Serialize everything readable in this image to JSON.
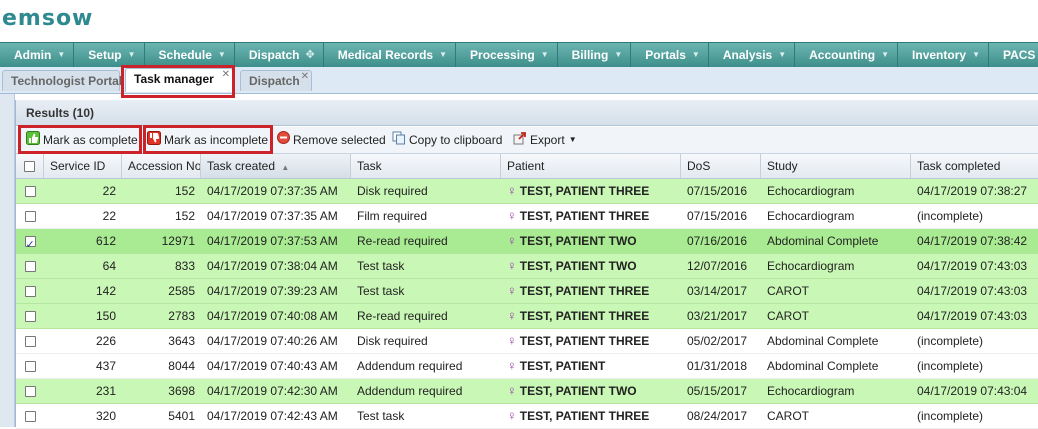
{
  "logo": {
    "text": "emsow"
  },
  "nav": [
    {
      "label": "Admin"
    },
    {
      "label": "Setup"
    },
    {
      "label": "Schedule"
    },
    {
      "label": "Dispatch",
      "active": true
    },
    {
      "label": "Medical Records"
    },
    {
      "label": "Processing"
    },
    {
      "label": "Billing"
    },
    {
      "label": "Portals"
    },
    {
      "label": "Analysis"
    },
    {
      "label": "Accounting"
    },
    {
      "label": "Inventory"
    },
    {
      "label": "PACS"
    },
    {
      "label": "De"
    }
  ],
  "tabs": {
    "technologist_portal": "Technologist Portal",
    "task_manager": "Task manager",
    "dispatch": "Dispatch",
    "close_glyph": "✕"
  },
  "results": {
    "title": "Results (10)"
  },
  "toolbar": {
    "mark_complete": "Mark as complete",
    "mark_incomplete": "Mark as incomplete",
    "remove_selected": "Remove selected",
    "copy_clipboard": "Copy to clipboard",
    "export": "Export"
  },
  "columns": {
    "service_id": "Service ID",
    "accession_no": "Accession No",
    "task_created": "Task created",
    "task": "Task",
    "patient": "Patient",
    "dos": "DoS",
    "study": "Study",
    "task_completed": "Task completed"
  },
  "rows": [
    {
      "checked": false,
      "done": true,
      "service_id": "22",
      "accession": "152",
      "created": "04/17/2019 07:37:35 AM",
      "task": "Disk required",
      "patient": "TEST, PATIENT THREE",
      "dos": "07/15/2016",
      "study": "Echocardiogram",
      "completed": "04/17/2019 07:38:27"
    },
    {
      "checked": false,
      "done": false,
      "service_id": "22",
      "accession": "152",
      "created": "04/17/2019 07:37:35 AM",
      "task": "Film required",
      "patient": "TEST, PATIENT THREE",
      "dos": "07/15/2016",
      "study": "Echocardiogram",
      "completed": "(incomplete)"
    },
    {
      "checked": true,
      "done": true,
      "service_id": "612",
      "accession": "12971",
      "created": "04/17/2019 07:37:53 AM",
      "task": "Re-read required",
      "patient": "TEST, PATIENT TWO",
      "dos": "07/16/2016",
      "study": "Abdominal Complete",
      "completed": "04/17/2019 07:38:42"
    },
    {
      "checked": false,
      "done": true,
      "service_id": "64",
      "accession": "833",
      "created": "04/17/2019 07:38:04 AM",
      "task": "Test task",
      "patient": "TEST, PATIENT TWO",
      "dos": "12/07/2016",
      "study": "Echocardiogram",
      "completed": "04/17/2019 07:43:03"
    },
    {
      "checked": false,
      "done": true,
      "service_id": "142",
      "accession": "2585",
      "created": "04/17/2019 07:39:23 AM",
      "task": "Test task",
      "patient": "TEST, PATIENT THREE",
      "dos": "03/14/2017",
      "study": "CAROT",
      "completed": "04/17/2019 07:43:03"
    },
    {
      "checked": false,
      "done": true,
      "service_id": "150",
      "accession": "2783",
      "created": "04/17/2019 07:40:08 AM",
      "task": "Re-read required",
      "patient": "TEST, PATIENT THREE",
      "dos": "03/21/2017",
      "study": "CAROT",
      "completed": "04/17/2019 07:43:03"
    },
    {
      "checked": false,
      "done": false,
      "service_id": "226",
      "accession": "3643",
      "created": "04/17/2019 07:40:26 AM",
      "task": "Disk required",
      "patient": "TEST, PATIENT THREE",
      "dos": "05/02/2017",
      "study": "Abdominal Complete",
      "completed": "(incomplete)"
    },
    {
      "checked": false,
      "done": false,
      "service_id": "437",
      "accession": "8044",
      "created": "04/17/2019 07:40:43 AM",
      "task": "Addendum required",
      "patient": "TEST, PATIENT",
      "dos": "01/31/2018",
      "study": "Abdominal Complete",
      "completed": "(incomplete)"
    },
    {
      "checked": false,
      "done": true,
      "service_id": "231",
      "accession": "3698",
      "created": "04/17/2019 07:42:30 AM",
      "task": "Addendum required",
      "patient": "TEST, PATIENT TWO",
      "dos": "05/15/2017",
      "study": "Echocardiogram",
      "completed": "04/17/2019 07:43:04"
    },
    {
      "checked": false,
      "done": false,
      "service_id": "320",
      "accession": "5401",
      "created": "04/17/2019 07:42:43 AM",
      "task": "Test task",
      "patient": "TEST, PATIENT THREE",
      "dos": "08/24/2017",
      "study": "CAROT",
      "completed": "(incomplete)"
    }
  ],
  "colors": {
    "nav_teal": "#4a9c98",
    "row_complete": "#c9f7b5",
    "incomplete_text": "#d0101a",
    "highlight_red": "#cc2229",
    "female_icon": "#9a3fa8"
  },
  "icons": {
    "nav_arrow": "chevron-down-icon",
    "dispatch_arrow": "move-icon",
    "mark_complete": "thumbs-up-icon",
    "mark_incomplete": "thumbs-down-icon",
    "remove": "remove-circle-icon",
    "copy": "copy-icon",
    "export": "export-icon",
    "patient_gender": "female-icon",
    "sort": "sort-ascending-icon"
  }
}
